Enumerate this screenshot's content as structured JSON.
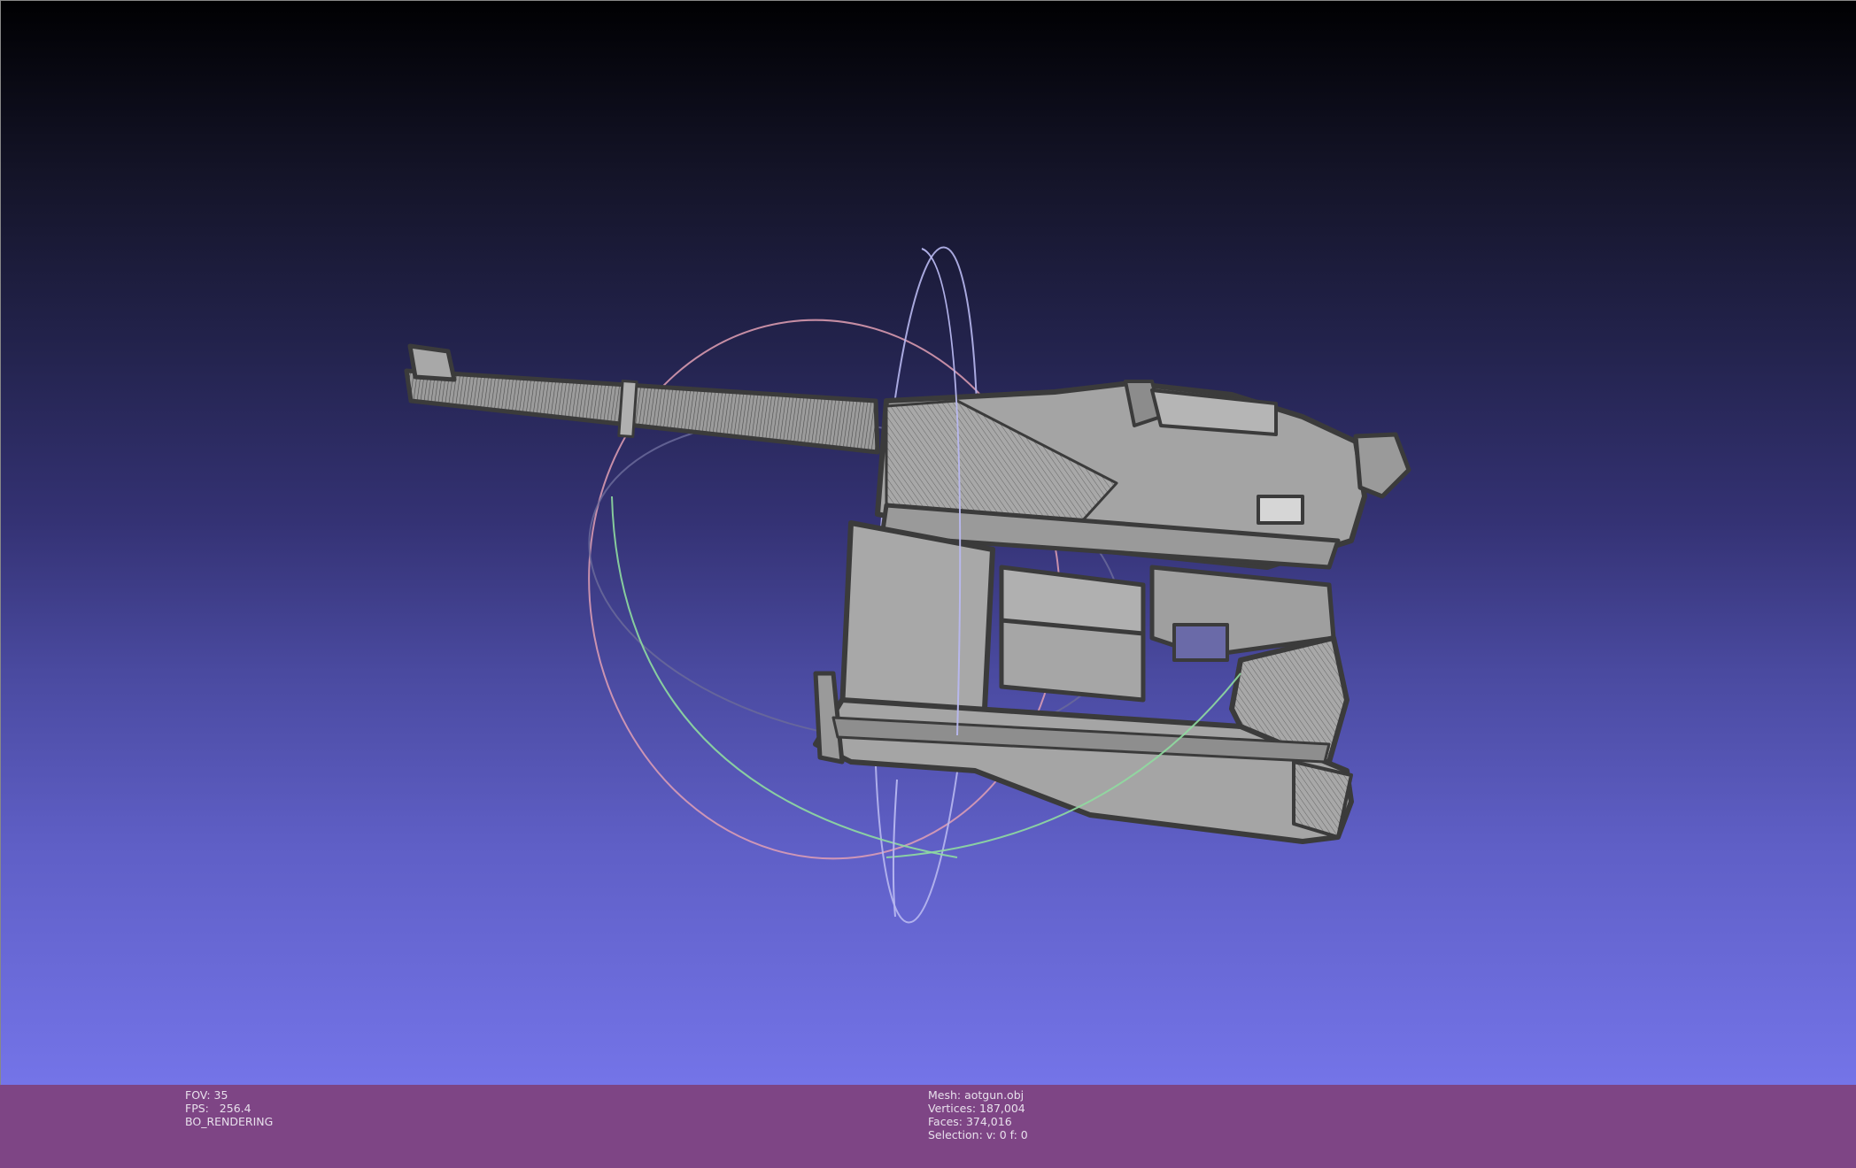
{
  "status_left": {
    "fov": "FOV: 35",
    "fps": "FPS:   256.4",
    "mode": "BO_RENDERING"
  },
  "status_mesh": {
    "mesh": "Mesh: aotgun.obj",
    "vertices": "Vertices: 187,004",
    "faces": "Faces: 374,016",
    "selection": "Selection: v: 0 f: 0"
  },
  "colors": {
    "background_top": "#000002",
    "background_bottom": "#7474e8",
    "info_bar": "#7e4585",
    "mesh_fill": "#a6a6a6",
    "mesh_edge": "#3a3a3a",
    "trackball_red": "#e89aa8",
    "trackball_green": "#8ee0a0",
    "trackball_blue": "#b0b0f0"
  },
  "icons": [
    "trackball-gizmo-icon",
    "mesh-model-icon"
  ]
}
